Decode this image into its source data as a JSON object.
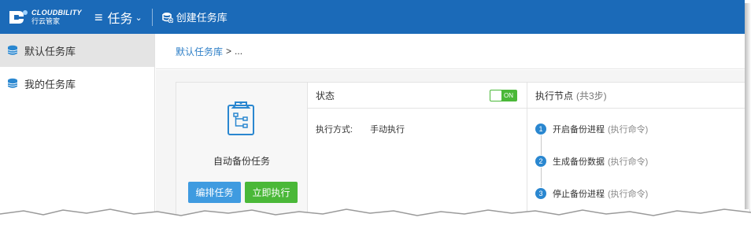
{
  "header": {
    "logo_en": "CLOUDBILITY",
    "logo_cn": "行云管家",
    "menu_label": "任务",
    "create_label": "创建任务库"
  },
  "sidebar": {
    "items": [
      {
        "label": "默认任务库",
        "icon": "database-icon",
        "active": true
      },
      {
        "label": "我的任务库",
        "icon": "database-icon",
        "active": false
      }
    ]
  },
  "breadcrumb": {
    "link": "默认任务库",
    "sep": ">",
    "current": "..."
  },
  "task": {
    "name": "自动备份任务",
    "edit_label": "编排任务",
    "run_label": "立即执行"
  },
  "status": {
    "title": "状态",
    "toggle_text": "ON",
    "mode_label": "执行方式:",
    "mode_value": "手动执行"
  },
  "nodes": {
    "title": "执行节点",
    "count": "(共3步)",
    "steps": [
      {
        "num": "1",
        "label": "开启备份进程",
        "note": "(执行命令)"
      },
      {
        "num": "2",
        "label": "生成备份数据",
        "note": "(执行命令)"
      },
      {
        "num": "3",
        "label": "停止备份进程",
        "note": "(执行命令)"
      }
    ]
  },
  "colors": {
    "topbar": "#1b6ab8",
    "accent_blue": "#3f9be0",
    "accent_green": "#4ab838",
    "link": "#2e7fc7"
  }
}
